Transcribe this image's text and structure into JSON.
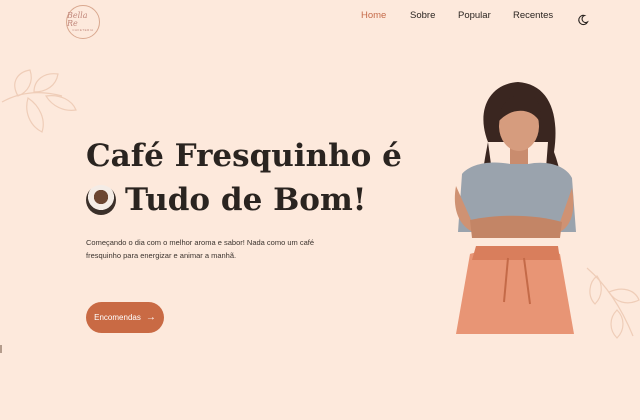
{
  "brand": {
    "logo_script": "Bella Re",
    "logo_tag": "CAFETERIA"
  },
  "nav": {
    "items": [
      {
        "label": "Home",
        "active": true
      },
      {
        "label": "Sobre"
      },
      {
        "label": "Popular"
      },
      {
        "label": "Recentes"
      }
    ],
    "theme_toggle_icon": "moon-icon"
  },
  "hero": {
    "title_line1": "Café Fresquinho é",
    "title_line2": "Tudo de Bom!",
    "title_icon": "coffee-cup-icon",
    "description": "Começando o dia com o melhor aroma e sabor! Nada como um café fresquinho para energizar e animar a manhã.",
    "cta_label": "Encomendas",
    "cta_icon": "arrow-right-icon"
  },
  "colors": {
    "background": "#fde9dc",
    "accent": "#c96a44",
    "active_nav": "#c56b4a"
  }
}
